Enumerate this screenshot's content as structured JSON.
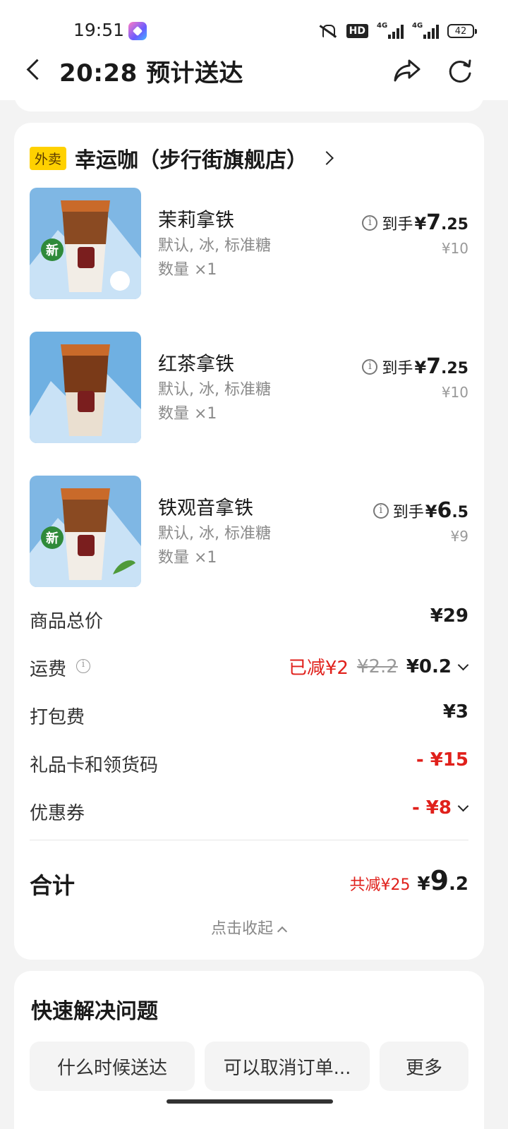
{
  "status_bar": {
    "time": "19:51",
    "hd": "HD",
    "net1": "4G",
    "net2": "4G",
    "battery": "42"
  },
  "header": {
    "title": "20:28 预计送达"
  },
  "store": {
    "badge": "外卖",
    "name": "幸运咖（步行街旗舰店）"
  },
  "items": [
    {
      "name": "茉莉拿铁",
      "spec": "默认, 冰, 标准糖",
      "qty": "数量 ×1",
      "price_prefix": "到手",
      "price_yen": "¥",
      "price_int": "7",
      "price_dec": ".25",
      "orig_price": "¥10"
    },
    {
      "name": "红茶拿铁",
      "spec": "默认, 冰, 标准糖",
      "qty": "数量 ×1",
      "price_prefix": "到手",
      "price_yen": "¥",
      "price_int": "7",
      "price_dec": ".25",
      "orig_price": "¥10"
    },
    {
      "name": "铁观音拿铁",
      "spec": "默认, 冰, 标准糖",
      "qty": "数量 ×1",
      "price_prefix": "到手",
      "price_yen": "¥",
      "price_int": "6",
      "price_dec": ".5",
      "orig_price": "¥9"
    }
  ],
  "fees": {
    "goods_total": {
      "label": "商品总价",
      "value": "¥29"
    },
    "delivery": {
      "label": "运费",
      "saved": "已减¥2",
      "original": "¥2.2",
      "value": "¥0.2"
    },
    "packing": {
      "label": "打包费",
      "value": "¥3"
    },
    "gift_card": {
      "label": "礼品卡和领货码",
      "value": "- ¥15"
    },
    "coupon": {
      "label": "优惠券",
      "value": "- ¥8"
    }
  },
  "total": {
    "label": "合计",
    "saved": "共减¥25",
    "yen": "¥",
    "int": "9",
    "dec": ".2"
  },
  "collapse_label": "点击收起",
  "help": {
    "title": "快速解决问题",
    "chips": [
      "什么时候送达",
      "可以取消订单...",
      "更多"
    ]
  }
}
